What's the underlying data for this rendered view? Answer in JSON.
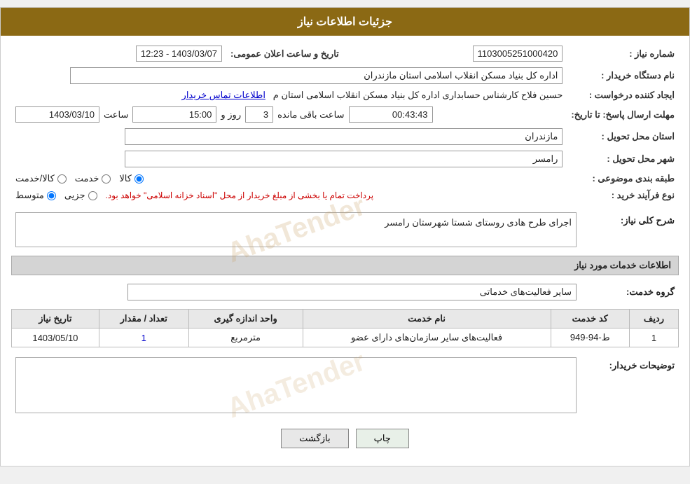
{
  "header": {
    "title": "جزئیات اطلاعات نیاز"
  },
  "fields": {
    "need_number_label": "شماره نیاز :",
    "need_number_value": "1103005251000420",
    "announce_date_label": "تاریخ و ساعت اعلان عمومی:",
    "announce_date_value": "1403/03/07 - 12:23",
    "buyer_org_label": "نام دستگاه خریدار :",
    "buyer_org_value": "اداره کل بنیاد مسکن انقلاب اسلامی استان مازندران",
    "creator_label": "ایجاد کننده درخواست :",
    "creator_value": "حسین فلاح کارشناس حسابداری اداره کل بنیاد مسکن انقلاب اسلامی استان م",
    "contact_link": "اطلاعات تماس خریدار",
    "deadline_label": "مهلت ارسال پاسخ: تا تاریخ:",
    "deadline_date": "1403/03/10",
    "deadline_time_label": "ساعت",
    "deadline_time": "15:00",
    "deadline_day_label": "روز و",
    "deadline_days": "3",
    "remaining_label": "ساعت باقی مانده",
    "remaining_time": "00:43:43",
    "delivery_province_label": "استان محل تحویل :",
    "delivery_province_value": "مازندران",
    "delivery_city_label": "شهر محل تحویل :",
    "delivery_city_value": "رامسر",
    "category_label": "طبقه بندی موضوعی :",
    "category_options": [
      "کالا",
      "خدمت",
      "کالا/خدمت"
    ],
    "category_selected": "کالا",
    "process_label": "نوع فرآیند خرید :",
    "process_options": [
      "جزیی",
      "متوسط"
    ],
    "process_selected": "متوسط",
    "process_note": "پرداخت تمام یا بخشی از مبلغ خریدار از محل \"اسناد خزانه اسلامی\" خواهد بود.",
    "need_desc_label": "شرح کلی نیاز:",
    "need_desc_value": "اجرای طرح هادی روستای شستا شهرستان رامسر",
    "services_section_label": "اطلاعات خدمات مورد نیاز",
    "service_group_label": "گروه خدمت:",
    "service_group_value": "سایر فعالیت‌های خدماتی",
    "table": {
      "headers": [
        "ردیف",
        "کد خدمت",
        "نام خدمت",
        "واحد اندازه گیری",
        "تعداد / مقدار",
        "تاریخ نیاز"
      ],
      "rows": [
        {
          "row": "1",
          "code": "ط-94-949",
          "name": "فعالیت‌های سایر سازمان‌های دارای عضو",
          "unit": "مترمربع",
          "count": "1",
          "date": "1403/05/10"
        }
      ]
    },
    "buyer_notes_label": "توضیحات خریدار:",
    "buyer_notes_value": ""
  },
  "buttons": {
    "print_label": "چاپ",
    "back_label": "بازگشت"
  }
}
